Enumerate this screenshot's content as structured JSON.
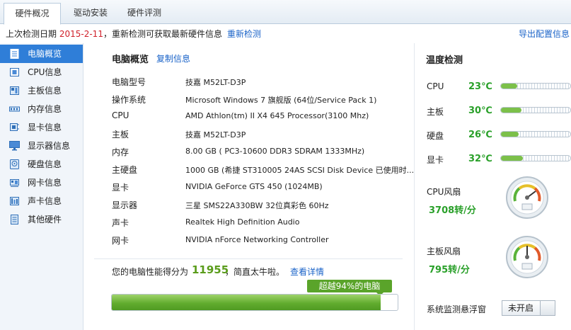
{
  "tabs": [
    {
      "label": "硬件概况",
      "active": true
    },
    {
      "label": "驱动安装",
      "active": false
    },
    {
      "label": "硬件评测",
      "active": false
    }
  ],
  "infobar": {
    "prefix": "上次检测日期",
    "date": "2015-2-11",
    "suffix": "，重新检测可获取最新硬件信息",
    "recheck": "重新检测",
    "export": "导出配置信息"
  },
  "sidebar": {
    "items": [
      {
        "label": "电脑概览",
        "icon": "document-icon",
        "active": true
      },
      {
        "label": "CPU信息",
        "icon": "cpu-icon"
      },
      {
        "label": "主板信息",
        "icon": "motherboard-icon"
      },
      {
        "label": "内存信息",
        "icon": "memory-icon"
      },
      {
        "label": "显卡信息",
        "icon": "graphics-card-icon"
      },
      {
        "label": "显示器信息",
        "icon": "monitor-icon"
      },
      {
        "label": "硬盘信息",
        "icon": "hard-disk-icon"
      },
      {
        "label": "网卡信息",
        "icon": "network-card-icon"
      },
      {
        "label": "声卡信息",
        "icon": "sound-card-icon"
      },
      {
        "label": "其他硬件",
        "icon": "other-hardware-icon"
      }
    ]
  },
  "overview": {
    "title": "电脑概览",
    "copy": "复制信息",
    "rows": [
      {
        "key": "电脑型号",
        "value": "技嘉 M52LT-D3P"
      },
      {
        "key": "操作系统",
        "value": "Microsoft Windows 7 旗舰版 (64位/Service Pack 1)"
      },
      {
        "key": "CPU",
        "value": "AMD Athlon(tm) II X4 645 Processor(3100 Mhz)"
      },
      {
        "key": "主板",
        "value": "技嘉 M52LT-D3P"
      },
      {
        "key": "内存",
        "value": "8.00 GB ( PC3-10600 DDR3 SDRAM 1333MHz)"
      },
      {
        "key": "主硬盘",
        "value": "1000 GB (希捷 ST310005 24AS SCSI Disk Device 已使用时..."
      },
      {
        "key": "显卡",
        "value": "NVIDIA GeForce GTS 450 (1024MB)"
      },
      {
        "key": "显示器",
        "value": "三星 SMS22A330BW 32位真彩色 60Hz"
      },
      {
        "key": "声卡",
        "value": "Realtek High Definition Audio"
      },
      {
        "key": "网卡",
        "value": "NVIDIA nForce Networking Controller"
      }
    ]
  },
  "score": {
    "prefix": "您的电脑性能得分为",
    "value": "11955",
    "suffix": "，简直太牛啦。",
    "detail": "查看详情",
    "badge": "超越94%的电脑",
    "percent": 94
  },
  "temperature": {
    "title": "温度检测",
    "items": [
      {
        "key": "CPU",
        "value": "23℃",
        "level": 0.23
      },
      {
        "key": "主板",
        "value": "30℃",
        "level": 0.3
      },
      {
        "key": "硬盘",
        "value": "26℃",
        "level": 0.26
      },
      {
        "key": "显卡",
        "value": "32℃",
        "level": 0.32
      }
    ]
  },
  "fans": [
    {
      "key": "CPU风扇",
      "value": "3708转/分"
    },
    {
      "key": "主板风扇",
      "value": "795转/分"
    }
  ],
  "float_monitor": {
    "label": "系统监测悬浮窗",
    "toggle": "未开启"
  },
  "colors": {
    "accent": "#2f7ed8",
    "date_red": "#d0202a",
    "good_green": "#2aa02a",
    "score_green": "#5a9c1b",
    "link": "#1a63c8"
  }
}
